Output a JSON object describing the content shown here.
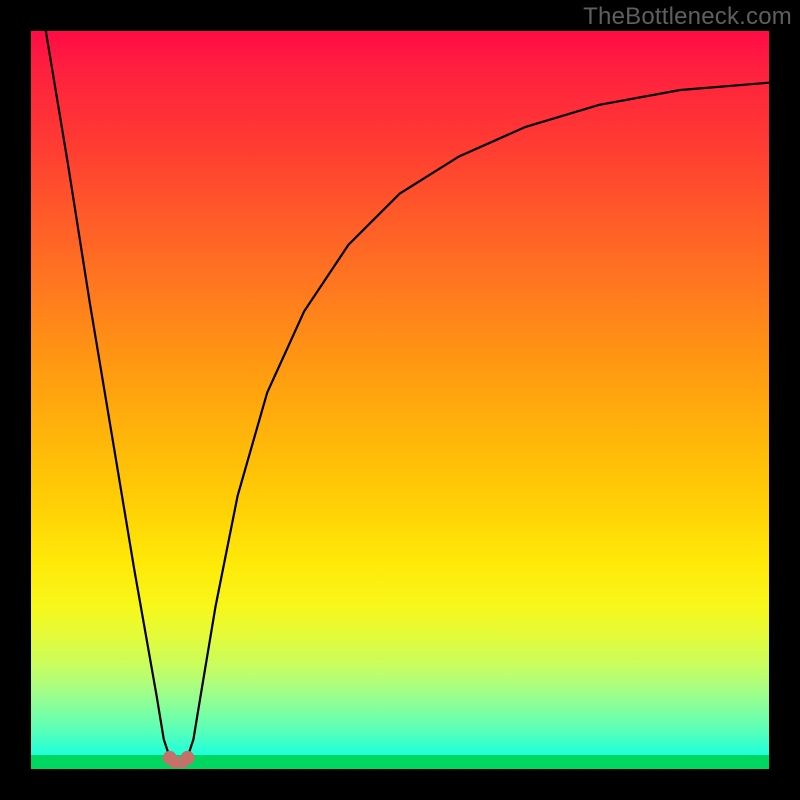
{
  "watermark": {
    "text": "TheBottleneck.com"
  },
  "chart_data": {
    "type": "line",
    "title": "",
    "xlabel": "",
    "ylabel": "",
    "xlim": [
      0,
      100
    ],
    "ylim": [
      0,
      100
    ],
    "grid": false,
    "note": "Background gradient encodes y as bottleneck severity: green≈0% (good) to red≈100% (severe). Single black curve; approximate values read from color bands.",
    "series": [
      {
        "name": "bottleneck-curve",
        "x": [
          2,
          5,
          8,
          11,
          14,
          17,
          18,
          19,
          20,
          21,
          22,
          23,
          25,
          28,
          32,
          37,
          43,
          50,
          58,
          67,
          77,
          88,
          100
        ],
        "values": [
          100,
          82,
          63,
          45,
          27,
          10,
          4,
          1,
          1,
          1,
          4,
          10,
          22,
          37,
          51,
          62,
          71,
          78,
          83,
          87,
          90,
          92,
          93
        ]
      }
    ],
    "markers": [
      {
        "name": "nub-left",
        "x": 18.8,
        "y": 1.5,
        "color": "#c57069"
      },
      {
        "name": "nub-right",
        "x": 21.2,
        "y": 1.5,
        "color": "#c57069"
      }
    ],
    "gradient_stops": [
      {
        "pct": 0,
        "color": "#ff0b45"
      },
      {
        "pct": 50,
        "color": "#ffc107"
      },
      {
        "pct": 80,
        "color": "#f7f71a"
      },
      {
        "pct": 100,
        "color": "#00ffea"
      }
    ]
  }
}
